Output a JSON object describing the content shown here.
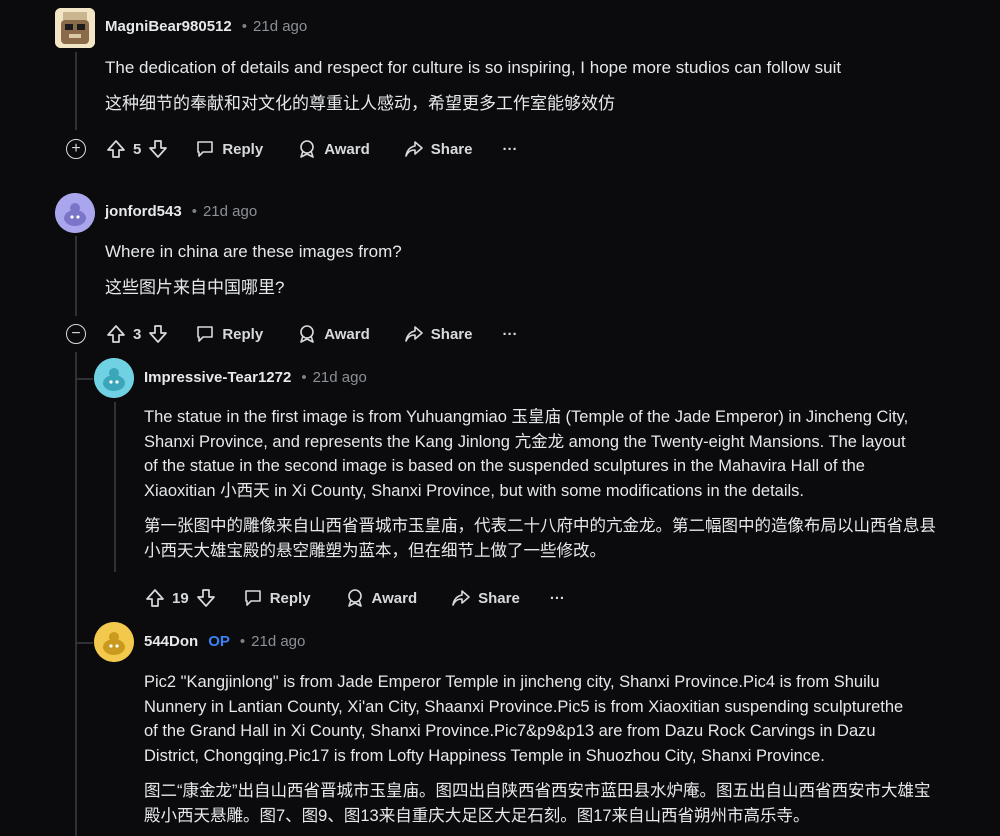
{
  "actions": {
    "reply": "Reply",
    "award": "Award",
    "share": "Share",
    "more": "···"
  },
  "comments": [
    {
      "username": "MagniBear980512",
      "age": "21d ago",
      "text_en": "The dedication of details and respect for culture is so inspiring, I hope more studios can follow suit",
      "text_zh": "这种细节的奉献和对文化的尊重让人感动，希望更多工作室能够效仿",
      "votes": "5",
      "toggle": "+"
    },
    {
      "username": "jonford543",
      "age": "21d ago",
      "text_en": "Where in china are these images from?",
      "text_zh": "这些图片来自中国哪里?",
      "votes": "3",
      "toggle": "−"
    },
    {
      "username": "Impressive-Tear1272",
      "age": "21d ago",
      "text_en_lines": [
        "The statue in the first image is from Yuhuangmiao 玉皇庙 (Temple of the Jade Emperor) in Jincheng City,",
        "Shanxi Province, and represents the Kang Jinlong 亢金龙 among the Twenty-eight Mansions. The layout",
        "of the statue in the second image is based on the suspended sculptures in the Mahavira Hall of the",
        "Xiaoxitian 小西天 in Xi County, Shanxi Province, but with some modifications in the details."
      ],
      "text_zh_lines": [
        "第一张图中的雕像来自山西省晋城市玉皇庙，代表二十八府中的亢金龙。第二幅图中的造像布局以山西省息县",
        "小西天大雄宝殿的悬空雕塑为蓝本，但在细节上做了一些修改。"
      ],
      "votes": "19"
    },
    {
      "username": "544Don",
      "op_badge": "OP",
      "age": "21d ago",
      "text_en_lines": [
        "Pic2 \"Kangjinlong\" is from Jade Emperor Temple in jincheng city, Shanxi Province.Pic4 is from Shuilu",
        "Nunnery in Lantian County, Xi'an City, Shaanxi Province.Pic5 is from Xiaoxitian suspending sculpturethe",
        "of the Grand Hall in Xi County, Shanxi Province.Pic7&p9&p13 are from Dazu Rock Carvings in Dazu",
        "District, Chongqing.Pic17 is from Lofty Happiness Temple in Shuozhou City, Shanxi Province."
      ],
      "text_zh_lines": [
        "图二“康金龙”出自山西省晋城市玉皇庙。图四出自陕西省西安市蓝田县水炉庵。图五出自山西省西安市大雄宝",
        "殿小西天悬雕。图7、图9、图13来自重庆大足区大足石刻。图17来自山西省朔州市高乐寺。"
      ]
    }
  ],
  "colors": {
    "background": "#0b0b0d",
    "text": "#e6e8ea",
    "meta": "#8b9096",
    "op": "#3b82f6"
  }
}
